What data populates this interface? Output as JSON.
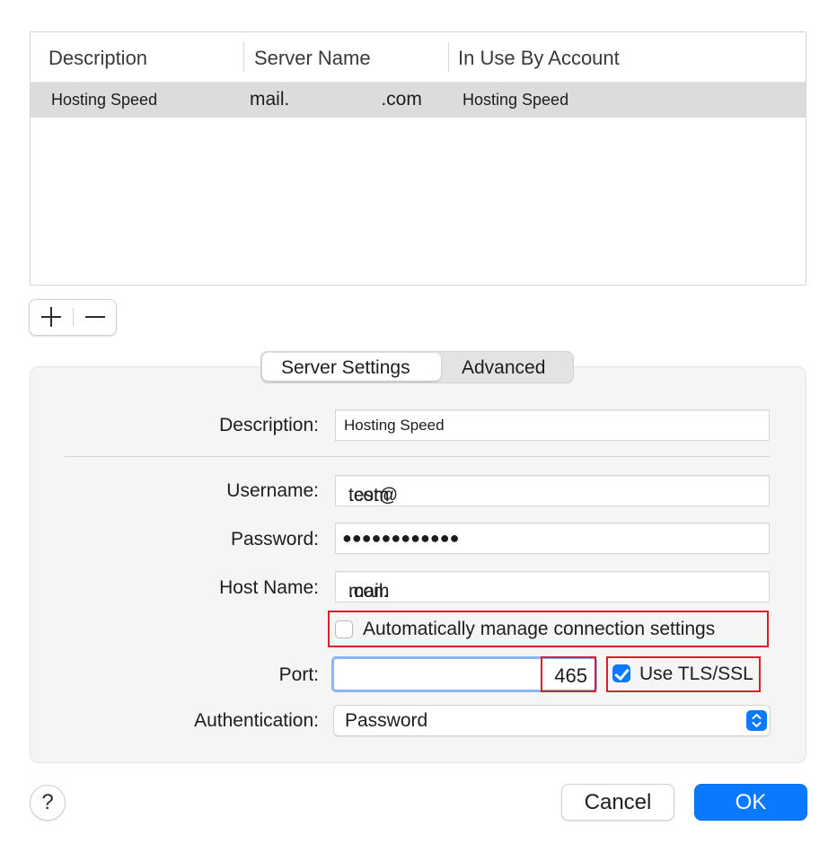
{
  "table": {
    "headers": [
      "Description",
      "Server Name",
      "In Use By Account"
    ],
    "rows": [
      {
        "description": "Hosting Speed",
        "server_prefix": "mail.",
        "server_suffix": ".com",
        "account": "Hosting Speed"
      }
    ]
  },
  "toolbar": {
    "add_label": "+",
    "remove_label": "−"
  },
  "tabs": {
    "server_settings": "Server Settings",
    "advanced": "Advanced",
    "selected": "Server Settings"
  },
  "form": {
    "description_label": "Description:",
    "description_value": "Hosting Speed",
    "username_label": "Username:",
    "username_prefix": "test@",
    "username_suffix": ".com",
    "password_label": "Password:",
    "password_value": "●●●●●●●●●●●●",
    "hostname_label": "Host Name:",
    "hostname_prefix": "mail.",
    "hostname_suffix": ".com",
    "auto_manage_label": "Automatically manage connection settings",
    "auto_manage_checked": false,
    "port_label": "Port:",
    "port_value": "465",
    "tls_label": "Use TLS/SSL",
    "tls_checked": true,
    "auth_label": "Authentication:",
    "auth_value": "Password"
  },
  "buttons": {
    "help": "?",
    "cancel": "Cancel",
    "ok": "OK"
  },
  "colors": {
    "accent": "#0a78ff",
    "highlight_box": "#d8202a",
    "selected_row": "#dcdcdc"
  }
}
